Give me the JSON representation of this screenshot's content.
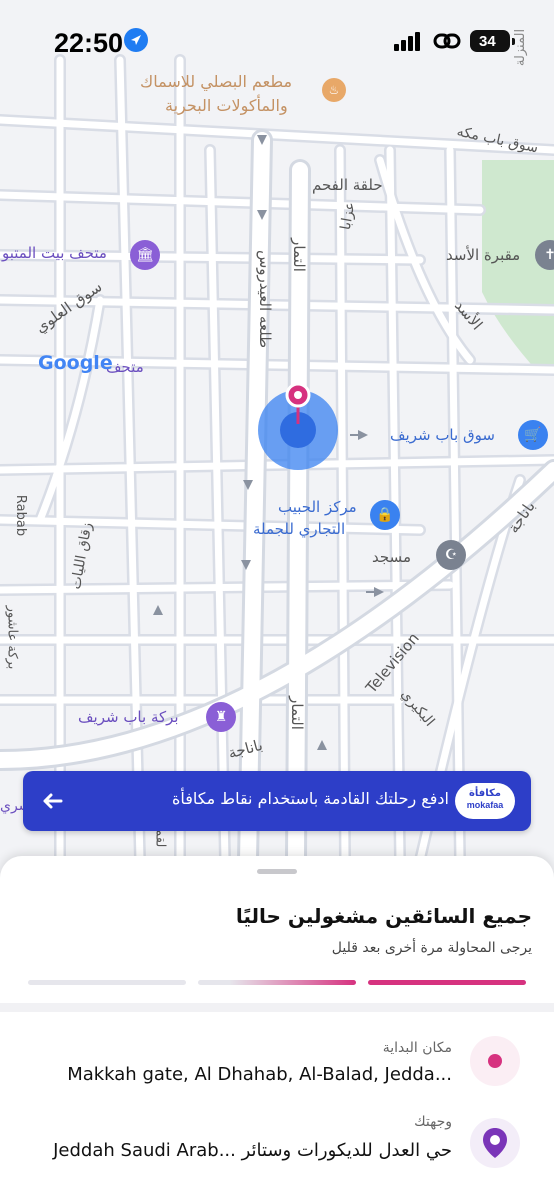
{
  "status_bar": {
    "time": "22:50",
    "battery": "34"
  },
  "map": {
    "labels": {
      "restaurant": "مطعم البصلي للاسماك",
      "restaurant2": "والمأكولات البحرية",
      "souq_bab_makkah": "سوق باب مكه",
      "halqat_alfahm": "حلقة الفحم",
      "azaba": "عزابا",
      "museum": "متحف بيت المتبو",
      "maqbarat": "مقبرة الأسد",
      "souq_alalawi": "سوق العلوي",
      "tal3a": "طلعه العيدروس",
      "altammar": "التمار",
      "alasad": "الأسد",
      "mutah": "متحف",
      "google": "Google",
      "souq_bab_sharif": "سوق باب شريف",
      "markaz1": "مركز الحبيب",
      "markaz2": "التجاري للجملة",
      "masjid": "مسجد",
      "zuqaq": "زقاق الليات",
      "birkat_bab_sharif": "بركة باب شريف",
      "altammar2": "التمار",
      "television": "Television",
      "albakri": "البكيري",
      "banaja": "باناجة",
      "banaja2": "باناجة",
      "almanzila": "المنزلة",
      "rabab": "Rabab",
      "birkat_ashour": "بركة عاشور",
      "luqi": "لقمان",
      "sharif_left": "شري"
    }
  },
  "promo": {
    "text": "ادفع رحلتك القادمة باستخدام نقاط مكافأة",
    "badge_ar": "مكافأة",
    "badge_en": "mokafaa"
  },
  "sheet": {
    "title": "جميع السائقين مشغولين حاليًا",
    "subtitle": "يرجى المحاولة مرة أخرى بعد قليل",
    "progress": [
      1,
      0.7,
      0
    ],
    "pickup_label": "مكان البداية",
    "pickup_value": "Makkah gate, Al Dhahab, Al-Balad, Jedda...",
    "dest_label": "وجهتك",
    "dest_value": "Jeddah Saudi Arab... حي العدل للديكورات وستائر"
  },
  "colors": {
    "accent": "#d6327f",
    "promo_bg": "#2d3ec8",
    "pin": "#d6327f",
    "dest_pin": "#7a35b8"
  }
}
